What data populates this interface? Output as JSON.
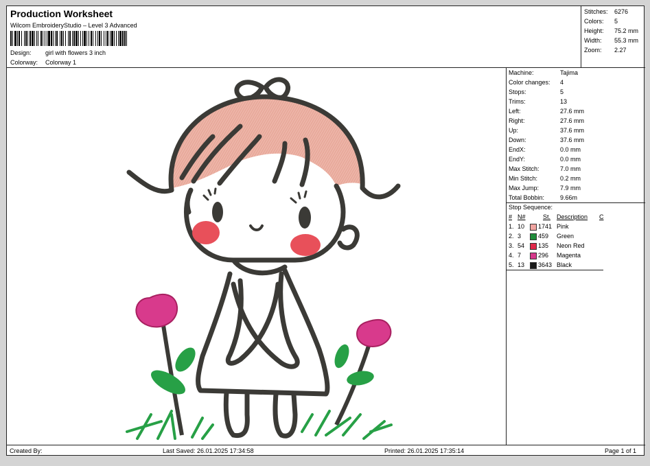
{
  "header": {
    "title": "Production Worksheet",
    "software": "Wilcom EmbroideryStudio – Level 3 Advanced",
    "design_label": "Design:",
    "design_value": "girl with flowers  3 inch",
    "colorway_label": "Colorway:",
    "colorway_value": "Colorway 1"
  },
  "summary": {
    "stitches_label": "Stitches:",
    "stitches": "6276",
    "colors_label": "Colors:",
    "colors": "5",
    "height_label": "Height:",
    "height": "75.2 mm",
    "width_label": "Width:",
    "width": "55.3 mm",
    "zoom_label": "Zoom:",
    "zoom": "2.27"
  },
  "machine": {
    "rows": [
      {
        "label": "Machine:",
        "value": "Tajima"
      },
      {
        "label": "Color changes:",
        "value": "4"
      },
      {
        "label": "Stops:",
        "value": "5"
      },
      {
        "label": "Trims:",
        "value": "13"
      },
      {
        "label": "Left:",
        "value": "27.6 mm"
      },
      {
        "label": "Right:",
        "value": "27.6 mm"
      },
      {
        "label": "Up:",
        "value": "37.6 mm"
      },
      {
        "label": "Down:",
        "value": "37.6 mm"
      },
      {
        "label": "EndX:",
        "value": "0.0 mm"
      },
      {
        "label": "EndY:",
        "value": "0.0 mm"
      },
      {
        "label": "Max Stitch:",
        "value": "7.0 mm"
      },
      {
        "label": "Min Stitch:",
        "value": "0.2 mm"
      },
      {
        "label": "Max Jump:",
        "value": "7.9 mm"
      },
      {
        "label": "Total Bobbin:",
        "value": "9.66m"
      }
    ]
  },
  "stop_sequence": {
    "title": "Stop Sequence:",
    "headers": {
      "num": "#",
      "needle": "N#",
      "stitches": "St.",
      "description": "Description",
      "code": "C"
    },
    "rows": [
      {
        "num": "1.",
        "needle": "10",
        "stitches": "1741",
        "description": "Pink",
        "color": "#f0a4a0"
      },
      {
        "num": "2.",
        "needle": "3",
        "stitches": "459",
        "description": "Green",
        "color": "#1e8c3a"
      },
      {
        "num": "3.",
        "needle": "54",
        "stitches": "135",
        "description": "Neon Red",
        "color": "#e0284a"
      },
      {
        "num": "4.",
        "needle": "7",
        "stitches": "296",
        "description": "Magenta",
        "color": "#d63a8c"
      },
      {
        "num": "5.",
        "needle": "13",
        "stitches": "3643",
        "description": "Black",
        "color": "#1a1a1a"
      }
    ]
  },
  "footer": {
    "created_by": "Created By:",
    "last_saved": "Last Saved: 26.01.2025 17:34:58",
    "printed": "Printed: 26.01.2025 17:35:14",
    "page": "Page 1 of 1"
  },
  "colors": {
    "thread_outline": "#3b3a36",
    "hair": "#e8aa9c",
    "cheek": "#e8505a",
    "flower": "#d83a8c",
    "leaf": "#27a046"
  }
}
